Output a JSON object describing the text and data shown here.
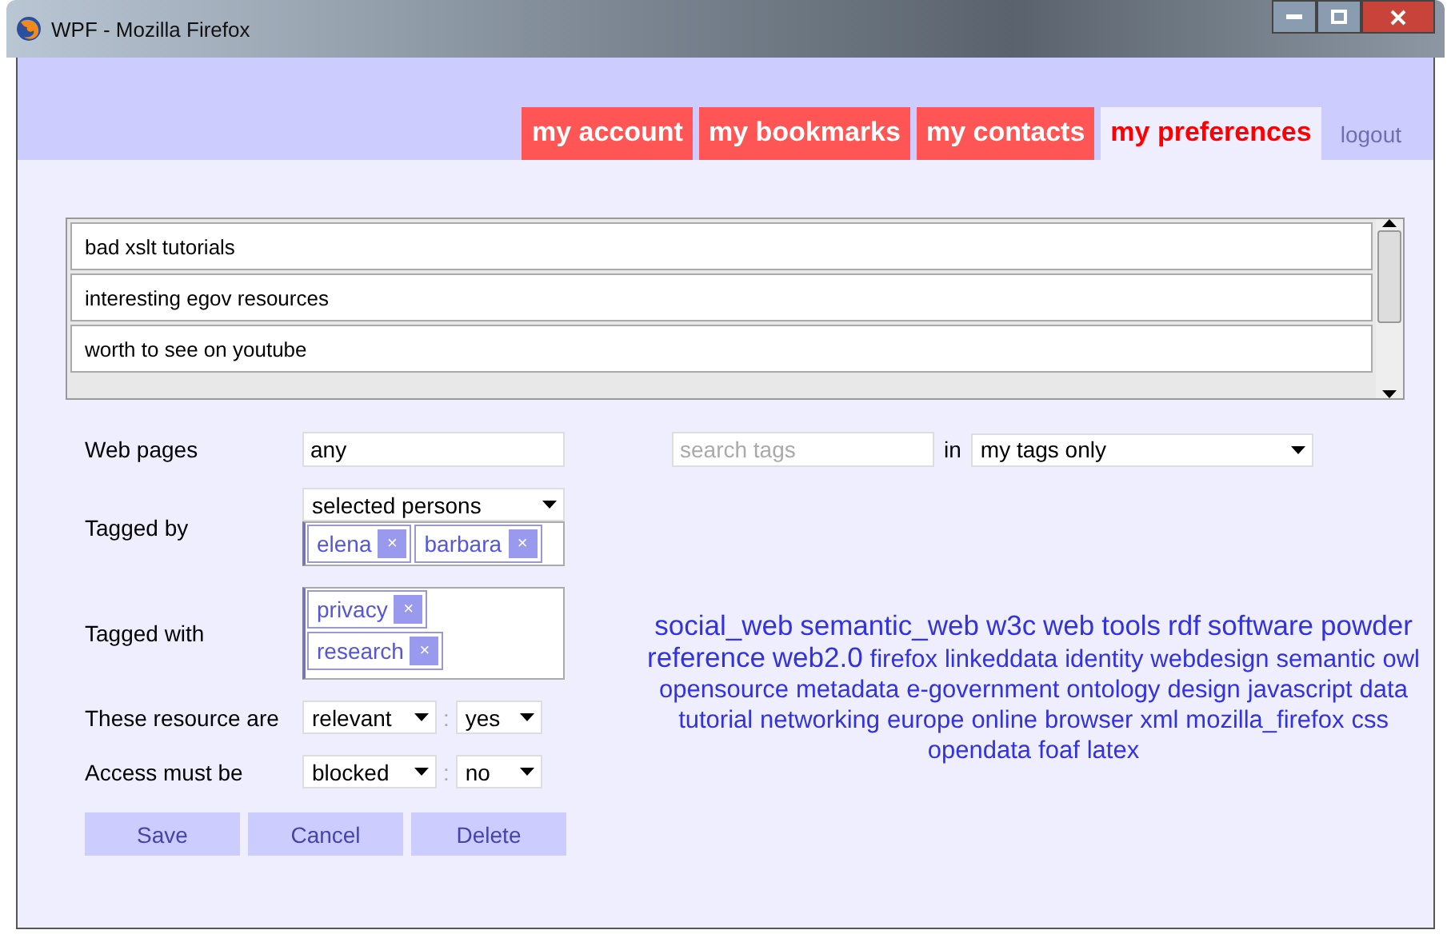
{
  "window": {
    "title": "WPF - Mozilla Firefox"
  },
  "tabs": [
    {
      "label": "my account",
      "selected": false
    },
    {
      "label": "my bookmarks",
      "selected": false
    },
    {
      "label": "my contacts",
      "selected": false
    },
    {
      "label": "my preferences",
      "selected": true
    }
  ],
  "logout": "logout",
  "bookmark_lists": [
    "bad xslt tutorials",
    "interesting egov resources",
    "worth to see on youtube"
  ],
  "form": {
    "web_pages": {
      "label": "Web pages",
      "value": "any"
    },
    "tagged_by": {
      "label": "Tagged by",
      "select": "selected persons",
      "chips": [
        "elena",
        "barbara"
      ]
    },
    "tagged_with": {
      "label": "Tagged with",
      "chips": [
        "privacy",
        "research"
      ]
    },
    "resource": {
      "label": "These resource are",
      "select": "relevant",
      "separator": ":",
      "value": "yes"
    },
    "access": {
      "label": "Access must be",
      "select": "blocked",
      "separator": ":",
      "value": "no"
    },
    "chip_remove": "×",
    "buttons": [
      "Save",
      "Cancel",
      "Delete"
    ]
  },
  "tag_search": {
    "placeholder": "search tags",
    "in": "in",
    "scope": "my tags only"
  },
  "tag_cloud": [
    {
      "text": "social_web",
      "kind": "large"
    },
    {
      "text": "semantic_web",
      "kind": "large"
    },
    {
      "text": "w3c",
      "kind": "large"
    },
    {
      "text": "web",
      "kind": "large"
    },
    {
      "text": "tools",
      "kind": "large"
    },
    {
      "text": "rdf",
      "kind": "large"
    },
    {
      "text": "software",
      "kind": "large"
    },
    {
      "text": "powder",
      "kind": "large"
    },
    {
      "text": "reference",
      "kind": "large"
    },
    {
      "text": "web2.0",
      "kind": "large"
    },
    {
      "text": "firefox",
      "kind": "normal"
    },
    {
      "text": "linkeddata",
      "kind": "normal"
    },
    {
      "text": "identity",
      "kind": "normal"
    },
    {
      "text": "webdesign",
      "kind": "normal"
    },
    {
      "text": "semantic",
      "kind": "normal"
    },
    {
      "text": "owl",
      "kind": "normal"
    },
    {
      "text": "opensource",
      "kind": "normal"
    },
    {
      "text": "metadata",
      "kind": "normal"
    },
    {
      "text": "e-government",
      "kind": "normal"
    },
    {
      "text": "ontology",
      "kind": "normal"
    },
    {
      "text": "design",
      "kind": "normal"
    },
    {
      "text": "javascript",
      "kind": "normal"
    },
    {
      "text": "data",
      "kind": "normal"
    },
    {
      "text": "tutorial",
      "kind": "normal"
    },
    {
      "text": "networking",
      "kind": "normal"
    },
    {
      "text": "europe",
      "kind": "normal"
    },
    {
      "text": "online",
      "kind": "normal"
    },
    {
      "text": "browser",
      "kind": "normal"
    },
    {
      "text": "xml",
      "kind": "normal"
    },
    {
      "text": "mozilla_firefox",
      "kind": "normal"
    },
    {
      "text": "css",
      "kind": "normal"
    },
    {
      "text": "opendata",
      "kind": "normal"
    },
    {
      "text": "foaf",
      "kind": "normal"
    },
    {
      "text": "latex",
      "kind": "normal"
    }
  ]
}
